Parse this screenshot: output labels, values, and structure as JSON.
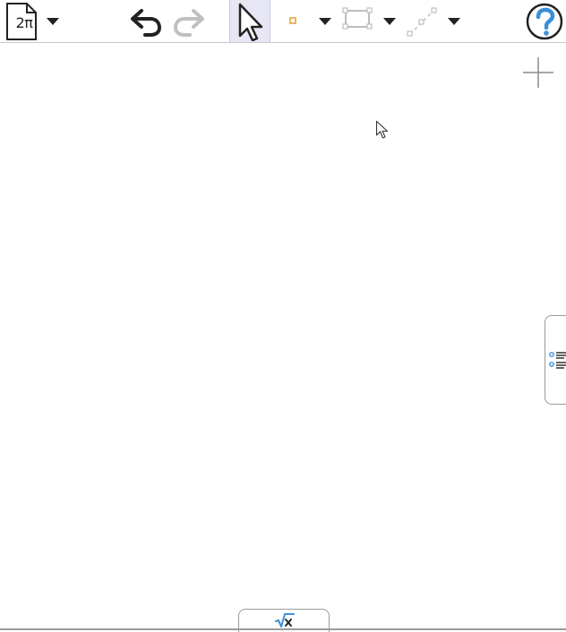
{
  "toolbar": {
    "file_label": "2π",
    "icons": [
      "file-icon",
      "undo-icon",
      "redo-icon",
      "select-arrow-icon",
      "point-icon",
      "rectangle-icon",
      "line-segment-icon",
      "help-icon"
    ]
  },
  "colors": {
    "accent_blue": "#3b8fd8",
    "point_orange": "#e8a33a",
    "selected_bg": "#e6e6f5",
    "disabled_gray": "#c0c0c0",
    "text_dark": "#222222"
  },
  "bottom_tab": {
    "icon": "sqrt-x-icon"
  },
  "side_tab": {
    "icon": "list-icon"
  }
}
